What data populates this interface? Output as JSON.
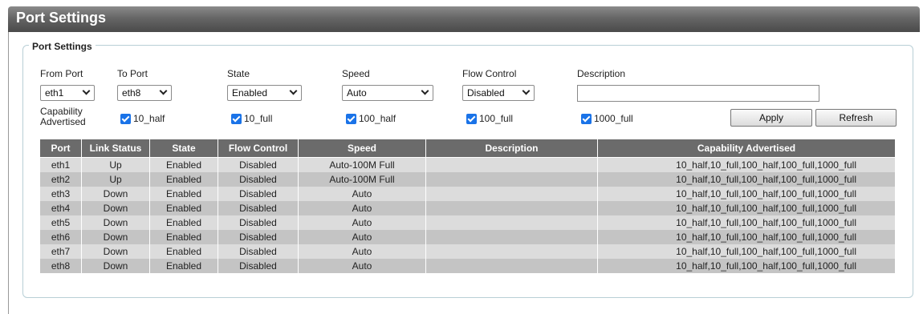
{
  "page": {
    "title": "Port Settings"
  },
  "form": {
    "legend": "Port Settings",
    "from_port": {
      "label": "From Port",
      "value": "eth1"
    },
    "to_port": {
      "label": "To Port",
      "value": "eth8"
    },
    "state": {
      "label": "State",
      "value": "Enabled"
    },
    "speed": {
      "label": "Speed",
      "value": "Auto"
    },
    "flow_control": {
      "label": "Flow Control",
      "value": "Disabled"
    },
    "description": {
      "label": "Description",
      "value": ""
    },
    "capability": {
      "label_line1": "Capability",
      "label_line2": "Advertised",
      "options": [
        {
          "label": "10_half",
          "checked": true
        },
        {
          "label": "10_full",
          "checked": true
        },
        {
          "label": "100_half",
          "checked": true
        },
        {
          "label": "100_full",
          "checked": true
        },
        {
          "label": "1000_full",
          "checked": true
        }
      ]
    },
    "apply_label": "Apply",
    "refresh_label": "Refresh"
  },
  "table": {
    "headers": [
      "Port",
      "Link Status",
      "State",
      "Flow Control",
      "Speed",
      "Description",
      "Capability Advertised"
    ],
    "rows": [
      [
        "eth1",
        "Up",
        "Enabled",
        "Disabled",
        "Auto-100M Full",
        "",
        "10_half,10_full,100_half,100_full,1000_full"
      ],
      [
        "eth2",
        "Up",
        "Enabled",
        "Disabled",
        "Auto-100M Full",
        "",
        "10_half,10_full,100_half,100_full,1000_full"
      ],
      [
        "eth3",
        "Down",
        "Enabled",
        "Disabled",
        "Auto",
        "",
        "10_half,10_full,100_half,100_full,1000_full"
      ],
      [
        "eth4",
        "Down",
        "Enabled",
        "Disabled",
        "Auto",
        "",
        "10_half,10_full,100_half,100_full,1000_full"
      ],
      [
        "eth5",
        "Down",
        "Enabled",
        "Disabled",
        "Auto",
        "",
        "10_half,10_full,100_half,100_full,1000_full"
      ],
      [
        "eth6",
        "Down",
        "Enabled",
        "Disabled",
        "Auto",
        "",
        "10_half,10_full,100_half,100_full,1000_full"
      ],
      [
        "eth7",
        "Down",
        "Enabled",
        "Disabled",
        "Auto",
        "",
        "10_half,10_full,100_half,100_full,1000_full"
      ],
      [
        "eth8",
        "Down",
        "Enabled",
        "Disabled",
        "Auto",
        "",
        "10_half,10_full,100_half,100_full,1000_full"
      ]
    ]
  },
  "colors": {
    "header_bar": "#5a5a5a",
    "table_header": "#6b6b6b",
    "row_light": "#dcdcdc",
    "row_dark": "#c4c4c4",
    "checkbox": "#1a73e8"
  }
}
